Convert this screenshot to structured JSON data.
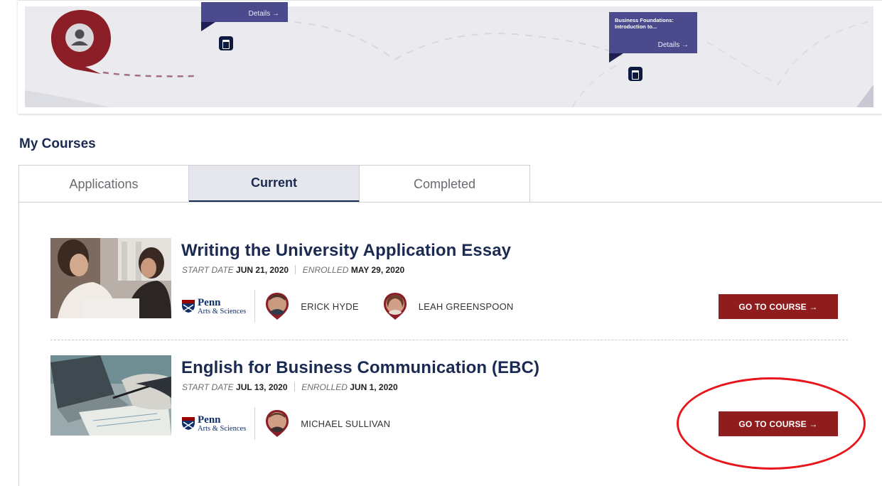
{
  "timeline": {
    "events": [
      {
        "title": "",
        "link": "Details →"
      },
      {
        "title": "Business Foundations: Introduction to...",
        "link": "Details →"
      }
    ]
  },
  "section_title": "My Courses",
  "tabs": [
    {
      "label": "Applications",
      "active": false
    },
    {
      "label": "Current",
      "active": true
    },
    {
      "label": "Completed",
      "active": false
    }
  ],
  "courses": [
    {
      "title": "Writing the University Application Essay",
      "start_label": "START DATE",
      "start_date": "JUN 21, 2020",
      "enrolled_label": "ENROLLED",
      "enrolled_date": "MAY 29, 2020",
      "provider": {
        "line1": "Penn",
        "line2": "Arts & Sciences"
      },
      "instructors": [
        "ERICK HYDE",
        "LEAH GREENSPOON"
      ],
      "button": "GO TO COURSE →"
    },
    {
      "title": "English for Business Communication (EBC)",
      "start_label": "START DATE",
      "start_date": "JUL 13, 2020",
      "enrolled_label": "ENROLLED",
      "enrolled_date": "JUN 1, 2020",
      "provider": {
        "line1": "Penn",
        "line2": "Arts & Sciences"
      },
      "instructors": [
        "MICHAEL SULLIVAN"
      ],
      "button": "GO TO COURSE →"
    }
  ],
  "colors": {
    "brand_red": "#8f1d1d",
    "navy": "#1b2a52",
    "event_purple": "#4a4a8c",
    "annotation_red": "#e8161a"
  }
}
